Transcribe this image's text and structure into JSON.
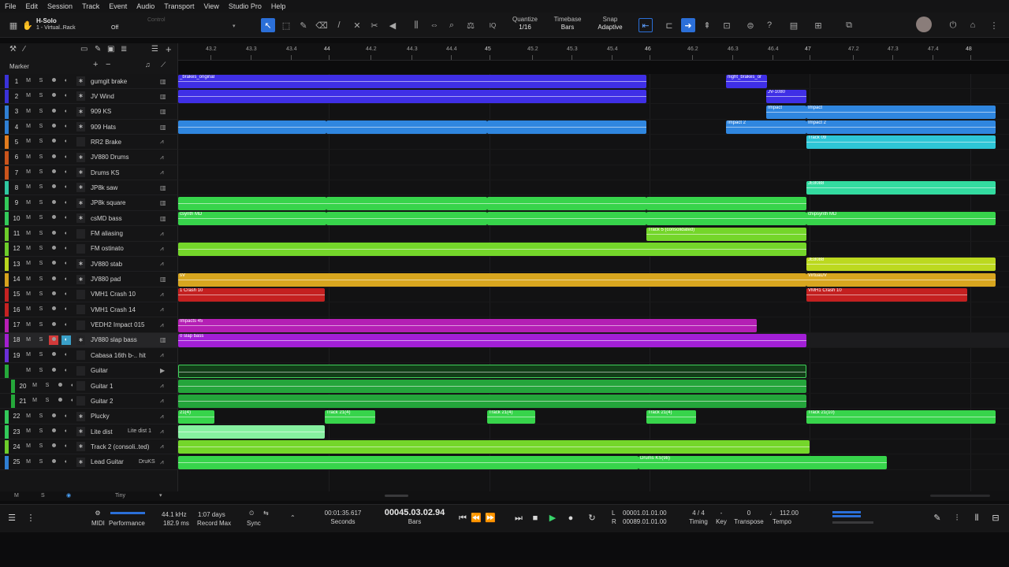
{
  "menu": [
    "File",
    "Edit",
    "Session",
    "Track",
    "Event",
    "Audio",
    "Transport",
    "View",
    "Studio Pro",
    "Help"
  ],
  "toolbar": {
    "solo_mode": "H-Solo",
    "instrument": "1 - Virtual..Rack",
    "off_label": "Off",
    "control_label": "Control",
    "quantize_label": "Quantize",
    "quantize_value": "1/16",
    "timebase_label": "Timebase",
    "timebase_value": "Bars",
    "snap_label": "Snap",
    "snap_value": "Adaptive"
  },
  "ruler": [
    "43.2",
    "43.3",
    "43.4",
    "44",
    "44.2",
    "44.3",
    "44.4",
    "45",
    "45.2",
    "45.3",
    "45.4",
    "46",
    "46.2",
    "46.3",
    "46.4",
    "47",
    "47.2",
    "47.3",
    "47.4",
    "48"
  ],
  "header": {
    "marker_label": "Marker"
  },
  "tracks": [
    {
      "num": "1",
      "name": "gumgit brake",
      "color": "#3a32d8"
    },
    {
      "num": "2",
      "name": "JV Wind",
      "color": "#3a32d8"
    },
    {
      "num": "3",
      "name": "909 KS",
      "color": "#2f7fd3"
    },
    {
      "num": "4",
      "name": "909 Hats",
      "color": "#2f7fd3"
    },
    {
      "num": "5",
      "name": "RR2 Brake",
      "color": "#e07b1e"
    },
    {
      "num": "6",
      "name": "JV880 Drums",
      "color": "#c9541c"
    },
    {
      "num": "7",
      "name": "Drums KS",
      "color": "#c9541c"
    },
    {
      "num": "8",
      "name": "JP8k saw",
      "color": "#2fc8a2"
    },
    {
      "num": "9",
      "name": "JP8k square",
      "color": "#33c95a"
    },
    {
      "num": "10",
      "name": "csMD bass",
      "color": "#33c95a"
    },
    {
      "num": "11",
      "name": "FM aliasing",
      "color": "#6ccc2a"
    },
    {
      "num": "12",
      "name": "FM ostinato",
      "color": "#6ccc2a"
    },
    {
      "num": "13",
      "name": "JV880 stab",
      "color": "#b9d61e"
    },
    {
      "num": "14",
      "name": "JV880 pad",
      "color": "#d6a21e"
    },
    {
      "num": "15",
      "name": "VMH1 Crash 10",
      "color": "#c52222"
    },
    {
      "num": "16",
      "name": "VMH1 Crash 14",
      "color": "#c52222"
    },
    {
      "num": "17",
      "name": "VEDH2 Impact 015",
      "color": "#b81fb5"
    },
    {
      "num": "18",
      "name": "JV880 slap bass",
      "color": "#a21fd0"
    },
    {
      "num": "19",
      "name": "Cabasa 16th b-.. hit",
      "color": "#6b2fd8"
    },
    {
      "num": "",
      "name": "Guitar",
      "color": "#25a83a"
    },
    {
      "num": "20",
      "name": "Guitar 1",
      "color": "#25a83a"
    },
    {
      "num": "21",
      "name": "Guitar 2",
      "color": "#25a83a"
    },
    {
      "num": "22",
      "name": "Plucky",
      "color": "#33c95a"
    },
    {
      "num": "23",
      "name": "Lite dist",
      "color": "#33c95a"
    },
    {
      "num": "24",
      "name": "Track 2 (consoli..ted)",
      "color": "#6ccc2a"
    },
    {
      "num": "25",
      "name": "Lead Guitar",
      "color": "#2f7fd3"
    }
  ],
  "track_extras": {
    "lite_dist_insert": "Lite dist 1",
    "lead_guitar_insert": "DruKS"
  },
  "clips": {
    "c1": "_brakes_original",
    "c2": "night_brakes_or",
    "c3": "JV-1080",
    "c4": "Impact",
    "c5": "Impact 2",
    "c6": "Impact 2",
    "c7": "Track 09",
    "c8": "JE8088",
    "c9": "csynth MD",
    "c10": "chipsynth MD",
    "c11": "Track 5 (consolidated)",
    "c12": "JE8088",
    "c13": "sV",
    "c14": "VirtualJV",
    "c15": "1 Crash 10",
    "c16": "VMH1 Crash 10",
    "c17": "Impacts 45",
    "c18": "0 slap bass",
    "c19": "21(4)",
    "c20": "Track 21(4)",
    "c21": "Track 21(4)",
    "c22": "Track 21(4)",
    "c23": "Track 21(10)",
    "c24": "Drums KS(98)"
  },
  "footer": {
    "m": "M",
    "s": "S",
    "zoom": "Tiny"
  },
  "transport": {
    "midi": "MIDI",
    "performance": "Performance",
    "samplerate": "44.1 kHz",
    "latency": "182.9 ms",
    "days": "1:07 days",
    "record_max": "Record Max",
    "sync": "Sync",
    "seconds_value": "00:01:35.617",
    "seconds_label": "Seconds",
    "bars_value": "00045.03.02.94",
    "bars_label": "Bars",
    "loop_l": "00001.01.01.00",
    "loop_r": "00089.01.01.00",
    "timing_value": "4 / 4",
    "timing_label": "Timing",
    "key_value": "-",
    "key_label": "Key",
    "transpose_value": "0",
    "transpose_label": "Transpose",
    "tempo_value": "112.00",
    "tempo_label": "Tempo"
  }
}
